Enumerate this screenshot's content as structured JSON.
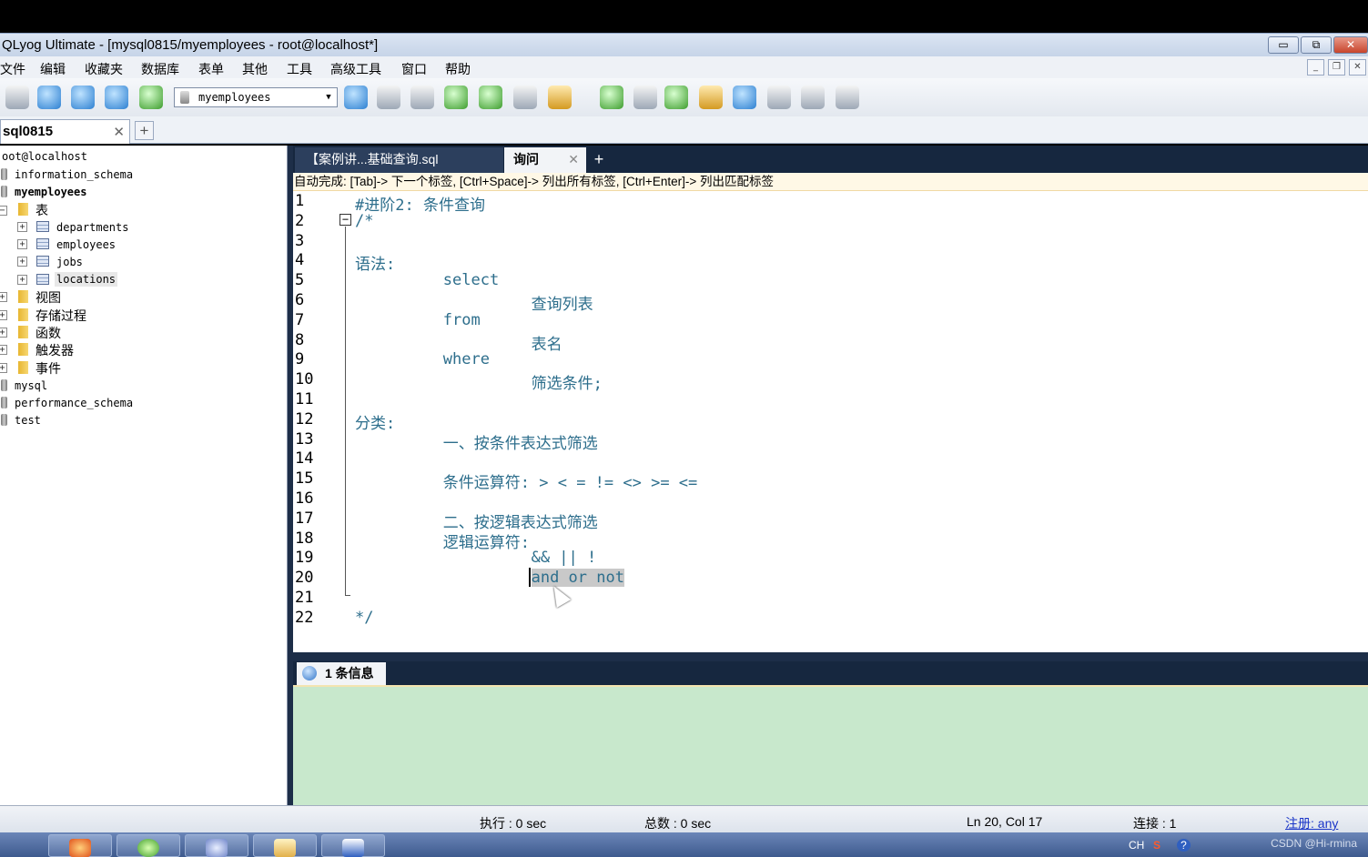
{
  "window": {
    "title": "QLyog Ultimate - [mysql0815/myemployees - root@localhost*]"
  },
  "menu": [
    "文件",
    "编辑",
    "收藏夹",
    "数据库",
    "表单",
    "其他",
    "工具",
    "高级工具",
    "窗口",
    "帮助"
  ],
  "toolbar": {
    "db_selector": "myemployees"
  },
  "connection_tab": {
    "label": "sql0815",
    "close": "✕",
    "add": "+"
  },
  "object_tree": {
    "root": "oot@localhost",
    "databases": [
      "information_schema",
      "myemployees",
      "mysql",
      "performance_schema",
      "test"
    ],
    "tables_folder": "表",
    "tables": [
      "departments",
      "employees",
      "jobs",
      "locations"
    ],
    "folders": [
      "视图",
      "存储过程",
      "函数",
      "触发器",
      "事件"
    ]
  },
  "query_tabs": [
    {
      "label": "【案例讲...基础查询.sql"
    },
    {
      "label": "询问",
      "close": "✕"
    }
  ],
  "query_tab_add": "+",
  "hint": "自动完成:  [Tab]-> 下一个标签,  [Ctrl+Space]-> 列出所有标签,  [Ctrl+Enter]-> 列出匹配标签",
  "editor": {
    "line_numbers": [
      "1",
      "2",
      "3",
      "4",
      "5",
      "6",
      "7",
      "8",
      "9",
      "10",
      "11",
      "12",
      "13",
      "14",
      "15",
      "16",
      "17",
      "18",
      "19",
      "20",
      "21",
      "22"
    ],
    "lines": [
      "#进阶2: 条件查询",
      "/*",
      "",
      "语法:",
      "        select",
      "                查询列表",
      "        from",
      "                表名",
      "        where",
      "                筛选条件;",
      "",
      "分类:",
      "        一、按条件表达式筛选",
      "",
      "        条件运算符: > < = != <> >= <=",
      "",
      "        二、按逻辑表达式筛选",
      "        逻辑运算符:",
      "                && || !",
      "                and or not",
      "",
      "*/"
    ],
    "fold_marker": "−"
  },
  "results": {
    "tab_label": "1 条信息"
  },
  "status": {
    "exec": "执行 : 0 sec",
    "total": "总数 : 0 sec",
    "position": "Ln 20, Col 17",
    "connections": "连接 : 1",
    "register": "注册:  any"
  },
  "taskbar": {
    "tray_lang": "CH",
    "watermark": "CSDN @Hi-rmina"
  },
  "colors": {
    "code": "#2d6e8c",
    "selection": "#c9c9c9",
    "results_bg": "#c8e8cc",
    "tab_bar": "#16273f"
  }
}
